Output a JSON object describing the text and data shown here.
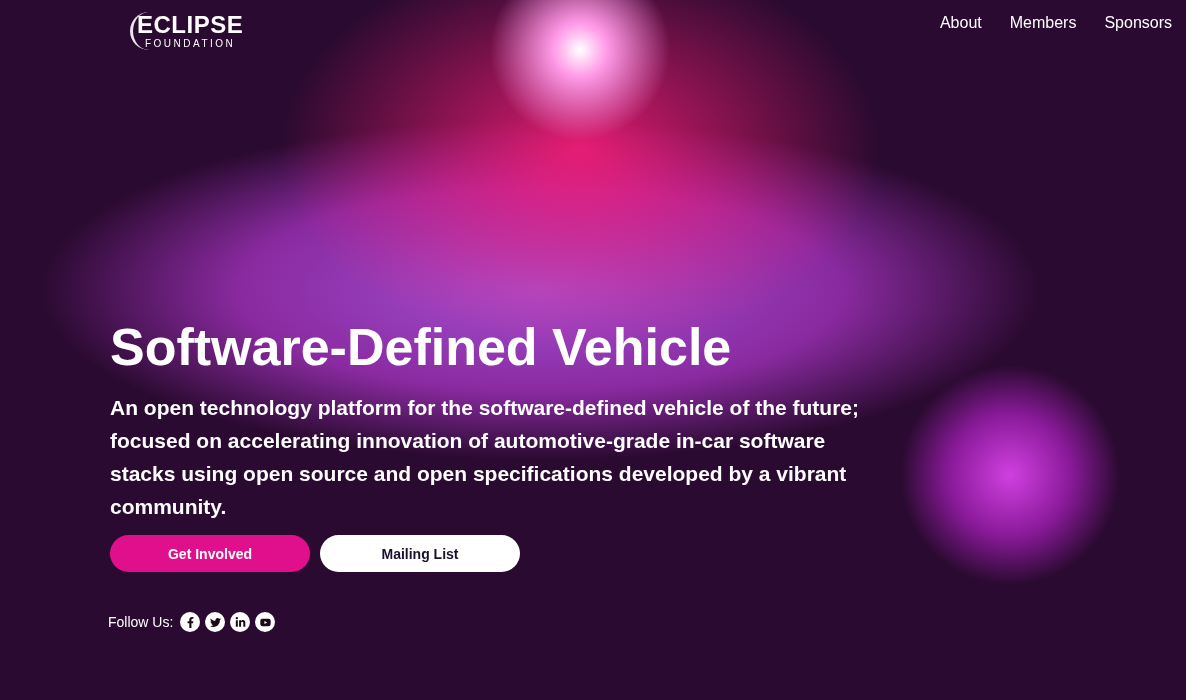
{
  "logo": {
    "name": "ECLIPSE",
    "subtitle": "FOUNDATION"
  },
  "nav": [
    "About",
    "Members",
    "Sponsors"
  ],
  "hero": {
    "title": "Software-Defined Vehicle",
    "description": "An open technology platform for the software-defined vehicle of the future; focused on accelerating innovation of automotive-grade in-car software stacks using open source and open specifications developed by a vibrant community.",
    "buttons": [
      {
        "label": "Get Involved",
        "kind": "primary"
      },
      {
        "label": "Mailing List",
        "kind": "secondary"
      }
    ]
  },
  "follow": {
    "label": "Follow Us:"
  }
}
